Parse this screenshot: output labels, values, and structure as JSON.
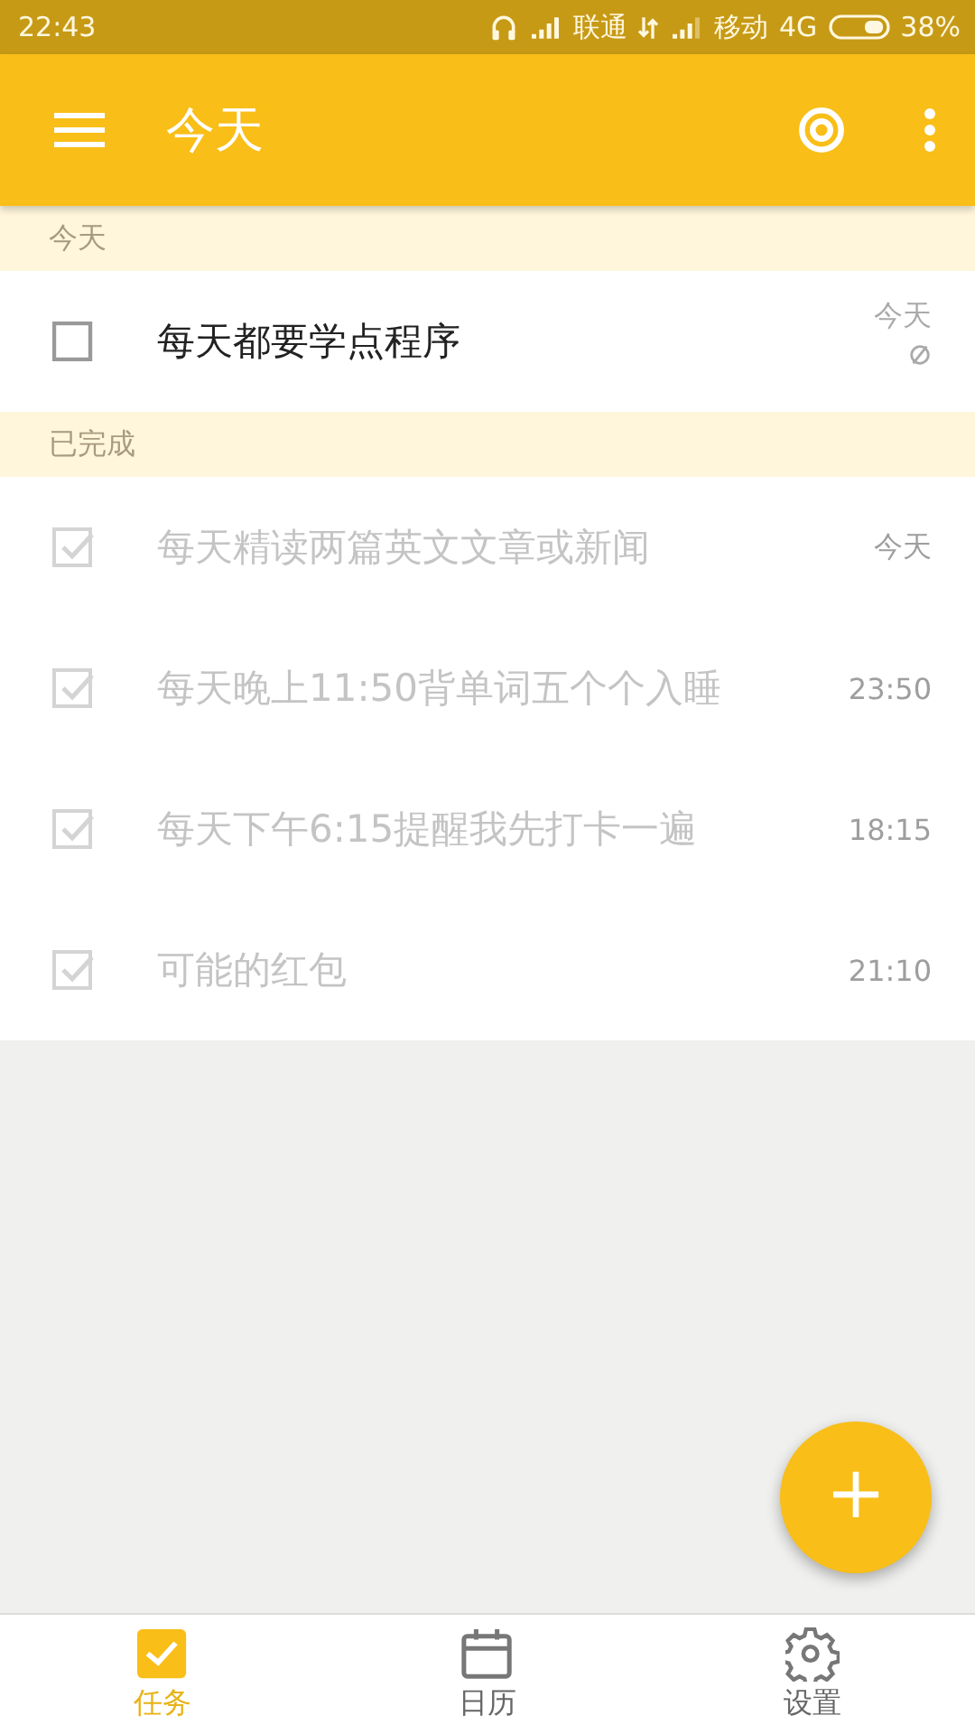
{
  "status_bar": {
    "time": "22:43",
    "carrier_1": "联通",
    "carrier_2": "移动",
    "network": "4G",
    "battery": "38%"
  },
  "app_bar": {
    "title": "今天"
  },
  "sections": [
    {
      "header": "今天",
      "tasks": [
        {
          "title": "每天都要学点程序",
          "time": "今天",
          "done": false,
          "repeating": true
        }
      ]
    },
    {
      "header": "已完成",
      "tasks": [
        {
          "title": "每天精读两篇英文文章或新闻",
          "time": "今天",
          "done": true,
          "repeating": false
        },
        {
          "title": "每天晚上11:50背单词五个个入睡",
          "time": "23:50",
          "done": true,
          "repeating": false
        },
        {
          "title": "每天下午6:15提醒我先打卡一遍",
          "time": "18:15",
          "done": true,
          "repeating": false
        },
        {
          "title": "可能的红包",
          "time": "21:10",
          "done": true,
          "repeating": false
        }
      ]
    }
  ],
  "fab": {
    "label": "+"
  },
  "bottom_nav": [
    {
      "label": "任务",
      "kind": "tasks",
      "selected": true
    },
    {
      "label": "日历",
      "kind": "calendar",
      "selected": false
    },
    {
      "label": "设置",
      "kind": "settings",
      "selected": false
    }
  ]
}
